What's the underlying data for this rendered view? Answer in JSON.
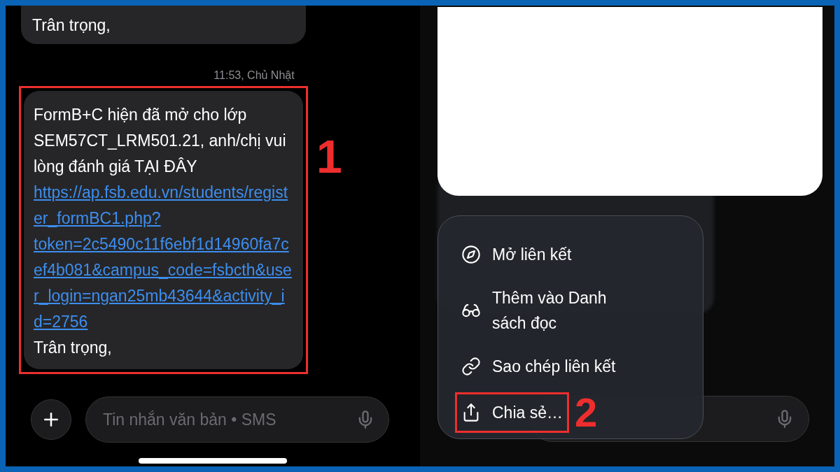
{
  "left_screen": {
    "previous_message": {
      "closing": "Trân trọng,"
    },
    "timestamp": "11:53, Chủ Nhật",
    "message": {
      "text": "FormB+C hiện đã mở cho lớp SEM57CT_LRM501.21, anh/chị vui lòng đánh giá TẠI ĐÂY",
      "link": "https://ap.fsb.edu.vn/students/register_formBC1.php?token=2c5490c11f6ebf1d14960fa7cef4b081&campus_code=fsbcth&user_login=ngan25mb43644&activity_id=2756",
      "closing": "Trân trọng,"
    },
    "annotation": "1",
    "composer": {
      "placeholder": "Tin nhắn văn bản • SMS"
    }
  },
  "right_screen": {
    "context_menu": [
      {
        "kind": "compass",
        "label": "Mở liên kết",
        "highlighted": false
      },
      {
        "kind": "glasses",
        "label": "Thêm vào Danh sách đọc",
        "highlighted": false
      },
      {
        "kind": "link",
        "label": "Sao chép liên kết",
        "highlighted": false
      },
      {
        "kind": "share",
        "label": "Chia sẻ…",
        "highlighted": true
      }
    ],
    "annotation": "2"
  }
}
